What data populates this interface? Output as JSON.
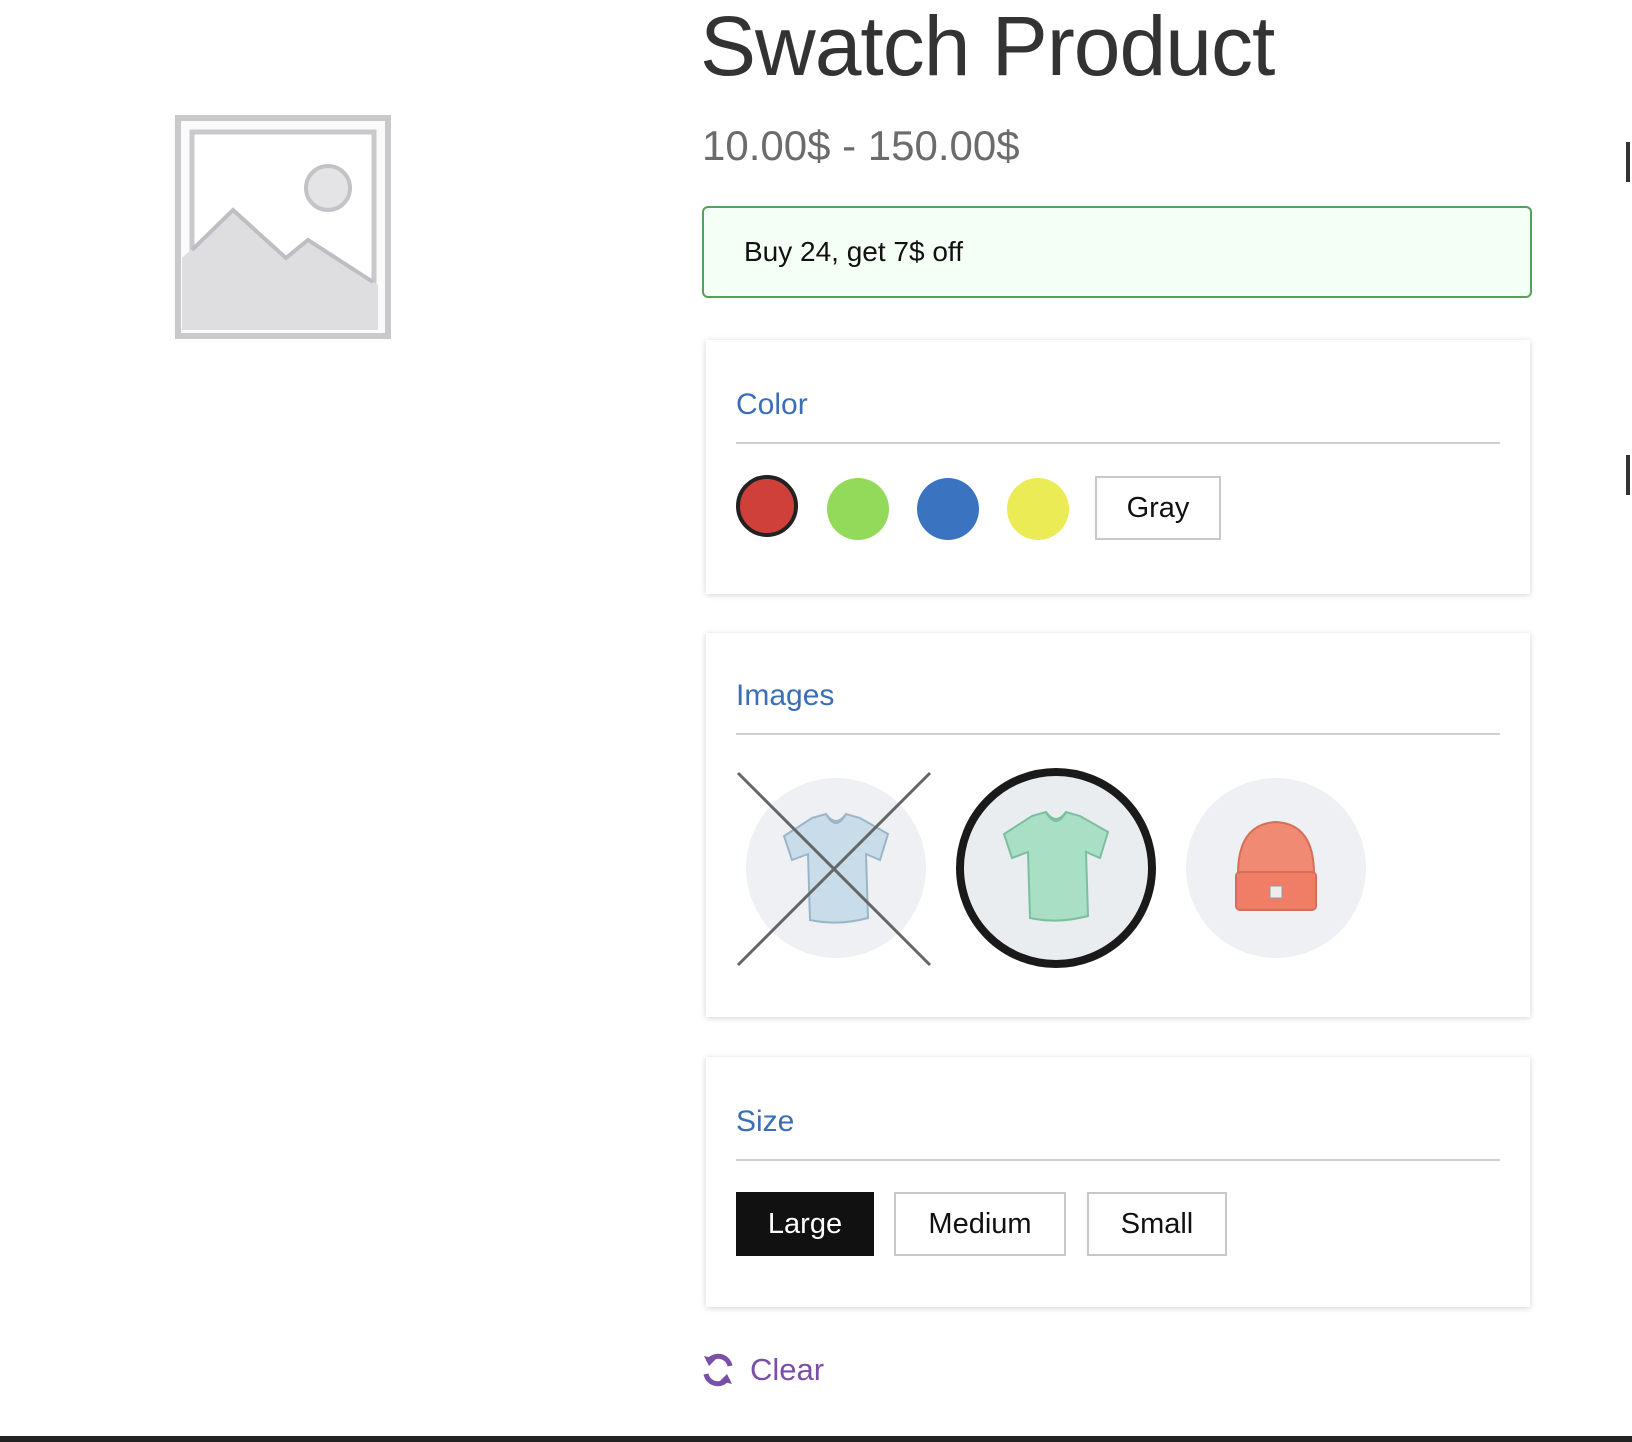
{
  "product": {
    "title": "Swatch Product",
    "price": "10.00$ - 150.00$",
    "promo": "Buy 24, get 7$ off"
  },
  "color": {
    "label": "Color",
    "swatches": [
      {
        "name": "Red",
        "hex": "#d0403a",
        "selected": true
      },
      {
        "name": "Green",
        "hex": "#93d95a",
        "selected": false
      },
      {
        "name": "Blue",
        "hex": "#3a74c0",
        "selected": false
      },
      {
        "name": "Yellow",
        "hex": "#ebeb56",
        "selected": false
      }
    ],
    "text_option": "Gray"
  },
  "images": {
    "label": "Images",
    "options": [
      {
        "icon": "blue-tshirt-icon",
        "state": "unavailable"
      },
      {
        "icon": "green-tshirt-icon",
        "state": "selected"
      },
      {
        "icon": "orange-beanie-icon",
        "state": "available"
      }
    ]
  },
  "size": {
    "label": "Size",
    "options": [
      "Large",
      "Medium",
      "Small"
    ],
    "selected": "Large"
  },
  "clear": {
    "label": "Clear",
    "icon": "refresh-icon",
    "color": "#7a4fa8"
  },
  "colors": {
    "accent": "#3a6fb5",
    "promo_border": "#55a05a"
  }
}
